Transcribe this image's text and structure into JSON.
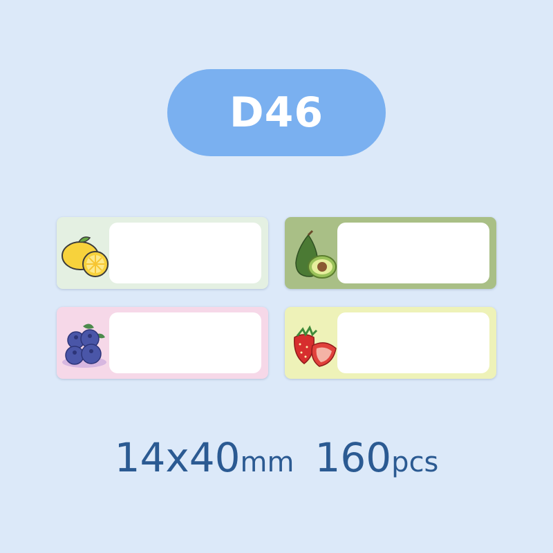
{
  "model": "D46",
  "size": {
    "dimension": "14x40",
    "dimension_unit": "mm",
    "count": "160",
    "count_unit": "pcs"
  },
  "labels": [
    {
      "fruit_icon": "lemon-icon",
      "background": "#e4f0e2"
    },
    {
      "fruit_icon": "avocado-icon",
      "background": "#a9bf86"
    },
    {
      "fruit_icon": "blueberry-icon",
      "background": "#f6d8e8"
    },
    {
      "fruit_icon": "strawberry-icon",
      "background": "#eef2b8"
    }
  ],
  "colors": {
    "background": "#dce9f9",
    "pill": "#7ab0f0",
    "text": "#2b5a92"
  }
}
